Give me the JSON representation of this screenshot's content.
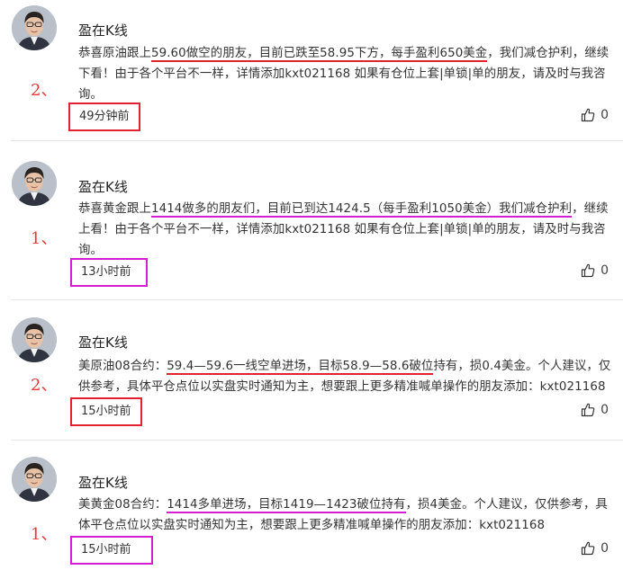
{
  "posts": [
    {
      "author": "盈在K线",
      "rank": "2、",
      "content": [
        {
          "t": "恭喜原油跟上",
          "u": ""
        },
        {
          "t": "59.60做空的朋友，目前已跌至58.95下方，每手盈利650美金",
          "u": "red"
        },
        {
          "t": "，我们减仓护利，继续下看！由于各个平台不一样，详情添加kxt021168 如果有仓位上套|单锁|单的朋友，请及时与我咨询。",
          "u": ""
        }
      ],
      "time": "49分钟前",
      "time_box": "red",
      "likes": "0"
    },
    {
      "author": "盈在K线",
      "rank": "1、",
      "content": [
        {
          "t": "恭喜黄金跟上",
          "u": ""
        },
        {
          "t": "1414做多的朋友们，目前已到达1424.5（每手盈利1050美金）我们减仓护利",
          "u": "mag"
        },
        {
          "t": "，继续上看！由于各个平台不一样，详情添加kxt021168 如果有仓位上套|单锁|单的朋友，请及时与我咨询。",
          "u": ""
        }
      ],
      "time": "13小时前",
      "time_box": "mag",
      "likes": "0"
    },
    {
      "author": "盈在K线",
      "rank": "2、",
      "content": [
        {
          "t": "美原油08合约：",
          "u": ""
        },
        {
          "t": "59.4—59.6一线空单进场，目标58.9—58.6破位",
          "u": "red"
        },
        {
          "t": "持有，损0.4美金。个人建议，仅供参考，具体平仓点位以实盘实时通知为主，想要跟上更多精准喊单操作的朋友添加：kxt021168",
          "u": ""
        }
      ],
      "time": "15小时前",
      "time_box": "red",
      "likes": "0"
    },
    {
      "author": "盈在K线",
      "rank": "1、",
      "content": [
        {
          "t": "美黄金08合约：",
          "u": ""
        },
        {
          "t": "1414多单进场，目标1419—1423破位持有",
          "u": "mag"
        },
        {
          "t": "，损4美金。个人建议，仅供参考，具体平仓点位以实盘实时通知为主，想要跟上更多精准喊单操作的朋友添加：kxt021168",
          "u": ""
        }
      ],
      "time": "15小时前",
      "time_box": "mag",
      "likes": "0"
    }
  ]
}
